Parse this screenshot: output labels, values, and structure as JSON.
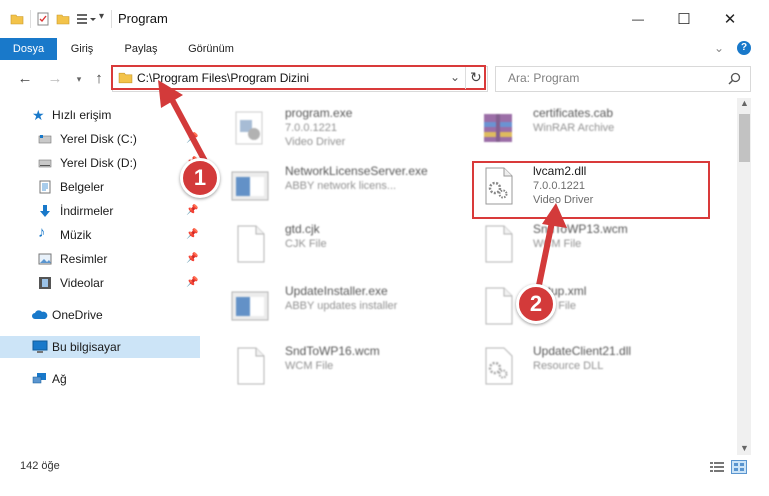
{
  "window": {
    "title": "Program",
    "minimize": "—",
    "maximize": "☐",
    "close": "✕"
  },
  "ribbon": {
    "tabs": [
      "Dosya",
      "Giriş",
      "Paylaş",
      "Görünüm"
    ]
  },
  "address": {
    "path": "C:\\Program Files\\Program Dizini"
  },
  "search": {
    "placeholder": "Ara: Program"
  },
  "sidebar": {
    "items": [
      {
        "label": "Hızlı erişim",
        "icon": "star-icon"
      },
      {
        "label": "Yerel Disk (C:)",
        "icon": "drive-icon"
      },
      {
        "label": "Yerel Disk (D:)",
        "icon": "drive-icon"
      },
      {
        "label": "Belgeler",
        "icon": "documents-icon"
      },
      {
        "label": "İndirmeler",
        "icon": "download-icon"
      },
      {
        "label": "Müzik",
        "icon": "music-icon"
      },
      {
        "label": "Resimler",
        "icon": "pictures-icon"
      },
      {
        "label": "Videolar",
        "icon": "videos-icon"
      },
      {
        "label": "OneDrive",
        "icon": "cloud-icon"
      },
      {
        "label": "Bu bilgisayar",
        "icon": "computer-icon"
      },
      {
        "label": "Ağ",
        "icon": "network-icon"
      }
    ]
  },
  "files": [
    {
      "name": "program.exe",
      "version": "7.0.0.1221",
      "type": "Video Driver"
    },
    {
      "name": "certificates.cab",
      "version": "",
      "type": "WinRAR Archive"
    },
    {
      "name": "NetworkLicenseServer.exe",
      "version": "",
      "type": "ABBY network licens..."
    },
    {
      "name": "lvcam2.dll",
      "version": "7.0.0.1221",
      "type": "Video Driver"
    },
    {
      "name": "gtd.cjk",
      "version": "",
      "type": "CJK File"
    },
    {
      "name": "SndToWP13.wcm",
      "version": "",
      "type": "WCM File"
    },
    {
      "name": "UpdateInstaller.exe",
      "version": "",
      "type": "ABBY updates installer"
    },
    {
      "name": "Setup.xml",
      "version": "",
      "type": "XML File"
    },
    {
      "name": "SndToWP16.wcm",
      "version": "",
      "type": "WCM File"
    },
    {
      "name": "UpdateClient21.dll",
      "version": "",
      "type": "Resource DLL"
    }
  ],
  "status": {
    "count": "142 öğe"
  },
  "annotations": {
    "step1": "1",
    "step2": "2"
  },
  "colors": {
    "accent": "#1979ca",
    "highlight": "#d93a3a"
  }
}
